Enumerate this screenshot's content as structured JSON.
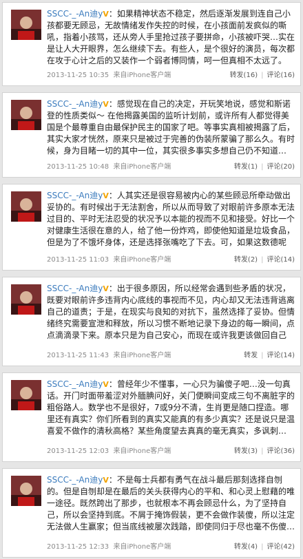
{
  "posts": [
    {
      "username": "SSCC-_-An迪y",
      "badge": "V",
      "text": "如果精神状态不稳定，然后逐渐发展到连自己小孩都要无顾忌，无故情绪发作失控的时候，在小孩面前发疯似的嘶吼，指着小孩骂，还从旁人手里抢过孩子要拼命，小孩被吓哭…实在是让人大开眼界，怎么继续下去。有些人，是个很好的演员，每次都在攻于心计之后的又装作一个弱者博同情，呵一但真相不太远了。",
      "time": "2013-11-25 10:35",
      "source": "来自iPhone客户端",
      "repost": "转发(16)",
      "comment": "评论(16)"
    },
    {
      "username": "SSCC-_-An迪y",
      "badge": "V",
      "text": "感觉现在自己的决定，开玩笑地说，感觉和斯诺登的性质类似～ 在他揭露美国的监听计划前，或许所有人都觉得美国是个最尊重自由最保护民主的国家了吧。等事实真相被揭露了后，其实大家才恍然，原来只是被过于完善的伪装所蒙骗了那么久。有时候，身为目睹一切的其中一位，其实很多事实多想自己仍不知道…",
      "time": "2013-11-25 10:48",
      "source": "来自iPhone客户端",
      "repost": "转发(1)",
      "comment": "评论(20)"
    },
    {
      "username": "SSCC-_-An迪y",
      "badge": "V",
      "text": "人其实还是很容易被内心的某些顾忌所牵动做出妥协的。有时候出于无法割舍，所以从而导致了对眼前许多原本无法过目的、平时无法忍受的状况予以本能的视而不见和接受。好比一个对健康生活很在意的人，给了他一份炸鸡，即使他知道是垃圾食品，但是为了不饿坏身体，还是选择张嘴吃了下去。可，如果这数德呢",
      "time": "2013-11-25 11:03",
      "source": "来自iPhone客户端",
      "repost": "转发(2)",
      "comment": "评论(14)"
    },
    {
      "username": "SSCC-_-An迪y",
      "badge": "V",
      "text": "出于很多原因，所以经常会遇到些矛盾的状况，既要对眼前许多违背内心底线的事视而不见，内心却又无法违背逃离自己的道责；于是，在现实与良知的对抗下，虽然选择了妥协。但情绪终究需要宣泄和释放，所以习惯不断地记录下身边的每一瞬间，点点滴滴录下来。原本只是为自己安心，而现在或许我更该做回自己",
      "time": "2013-11-25 11:43",
      "source": "来自iPhone客户端",
      "repost": "转发",
      "comment": "评论(14)"
    },
    {
      "username": "SSCC-_-An迪y",
      "badge": "V",
      "text": "曾经年少不懂事，一心只为骗傻子吧…没一句真话。开门时面带羞涩对外腼腆问好，关门便瞬间变成三句不离脏字的粗俗路人。数学也不是很好，7或9分不清，生肖更是随口捏造。哪里还有真实？你们所看到的真实又能真的有多少真实？还是说只是温喜爱不做作的清秋高格？某些角度望去真真的毫无真实，多讽刺…",
      "time": "2013-11-25 12:03",
      "source": "来自iPhone客户端",
      "repost": "转发(3)",
      "comment": "评论(36)"
    },
    {
      "username": "SSCC-_-An迪y",
      "badge": "V",
      "text": "不是每士兵都有勇气在战斗最后那刻选择自刎的。但是自刎却是在最后的关头获得内心的平和、和心灵上慰藉的唯一途径。既然跨出了那步，也就根本不再会顾忌什么，为了坚持自己，所以会坚持到底。不屑于掩饰假装，更不会做作装傻，所以注定无法做人生赢家；但当底线被屡次践踏，即使同归于尽也毫不伤傻…",
      "time": "2013-11-25 12:33",
      "source": "来自iPhone客户端",
      "repost": "转发(4)",
      "comment": "评论(42)"
    }
  ]
}
